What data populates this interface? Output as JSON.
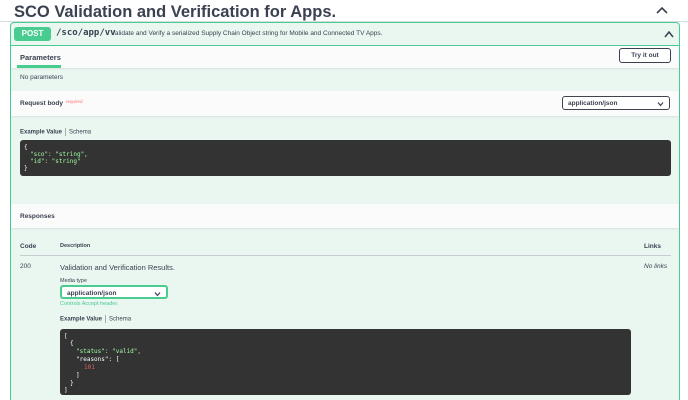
{
  "tag": {
    "title": "SCO Validation and Verification for Apps."
  },
  "operation": {
    "method": "POST",
    "path": "/sco/app/vv",
    "description": "Validate and Verify a serialized Supply Chain Object string for Mobile and Connected TV Apps."
  },
  "parameters": {
    "tab_label": "Parameters",
    "try_button": "Try it out",
    "empty_text": "No parameters"
  },
  "request_body": {
    "label": "Request body",
    "required": "required",
    "content_type": "application/json",
    "example_tab": "Example Value",
    "schema_tab": "Schema",
    "example_lines": [
      "{",
      "\"sco\": \"string\",",
      "\"id\": \"string\"",
      "}"
    ]
  },
  "responses": {
    "title": "Responses",
    "headers": {
      "code": "Code",
      "description": "Description",
      "links": "Links"
    },
    "rows": [
      {
        "code": "200",
        "description": "Validation and Verification Results.",
        "links": "No links",
        "media_type_label": "Media type",
        "media_type": "application/json",
        "controls_text": "Controls Accept header.",
        "example_tab": "Example Value",
        "schema_tab": "Schema",
        "example_lines": [
          "[",
          "{",
          "\"status\": \"valid\",",
          "\"reasons\": [",
          "101",
          "]",
          "}",
          "]"
        ]
      }
    ]
  },
  "colors": {
    "post": "#49cc90",
    "post_bg": "#eaf6f0",
    "code_bg": "#333333",
    "string": "#a2fca2",
    "number": "#d36363",
    "required": "#ff6f6f"
  },
  "icons": [
    "chevron-up-icon",
    "chevron-down-icon"
  ]
}
